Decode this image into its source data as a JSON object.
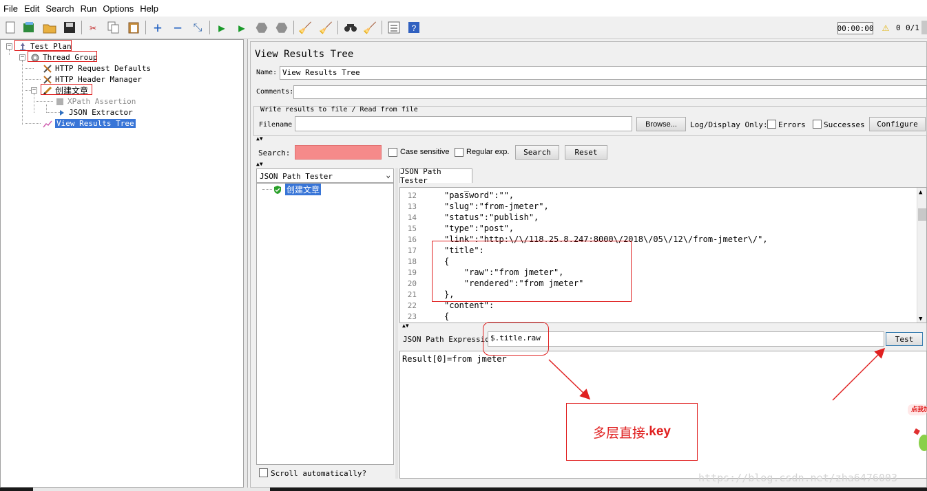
{
  "menu": [
    "File",
    "Edit",
    "Search",
    "Run",
    "Options",
    "Help"
  ],
  "toolbar": {
    "timer": "00:00:00",
    "warnings": "0",
    "threads": "0/1",
    "icons": [
      "new-icon",
      "templates-icon",
      "open-icon",
      "save-icon",
      "cut-icon",
      "copy-icon",
      "paste-icon",
      "expand-icon",
      "collapse-icon",
      "toggle-icon",
      "start-icon",
      "start-no-pause-icon",
      "stop-icon",
      "shutdown-icon",
      "clear-icon",
      "clear-all-icon",
      "search-icon",
      "reset-search-icon",
      "function-helper-icon",
      "help-icon"
    ]
  },
  "tree": {
    "test_plan": "Test Plan",
    "thread_group": "Thread Group",
    "http_defaults": "HTTP Request Defaults",
    "header_manager": "HTTP Header Manager",
    "sampler": "创建文章",
    "xpath": "XPath Assertion",
    "json_extractor": "JSON Extractor",
    "view_results": "View Results Tree"
  },
  "panel": {
    "title": "View Results Tree",
    "name_label": "Name:",
    "name_value": "View Results Tree",
    "comments_label": "Comments:",
    "write_section": "Write results to file / Read from file",
    "filename_label": "Filename",
    "filename_value": "",
    "browse": "Browse...",
    "log_display": "Log/Display Only:",
    "errors": "Errors",
    "successes": "Successes",
    "configure": "Configure",
    "search_label": "Search:",
    "search_value": "",
    "case_sensitive": "Case sensitive",
    "regular_exp": "Regular exp.",
    "search_btn": "Search",
    "reset_btn": "Reset"
  },
  "results": {
    "renderer": "JSON Path Tester",
    "sample": "创建文章",
    "scroll_auto": "Scroll automatically?",
    "tab": "JSON Path Tester",
    "code_lines": [
      {
        "n": "12",
        "t": "\"password\":\"\","
      },
      {
        "n": "13",
        "t": "\"slug\":\"from-jmeter\","
      },
      {
        "n": "14",
        "t": "\"status\":\"publish\","
      },
      {
        "n": "15",
        "t": "\"type\":\"post\","
      },
      {
        "n": "16",
        "t": "\"link\":\"http:\\/\\/118.25.8.247:8000\\/2018\\/05\\/12\\/from-jmeter\\/\","
      },
      {
        "n": "17",
        "t": "\"title\":"
      },
      {
        "n": "18",
        "t": "{"
      },
      {
        "n": "19",
        "t": "    \"raw\":\"from jmeter\","
      },
      {
        "n": "20",
        "t": "    \"rendered\":\"from jmeter\""
      },
      {
        "n": "21",
        "t": "},"
      },
      {
        "n": "22",
        "t": "\"content\":"
      },
      {
        "n": "23",
        "t": "{"
      }
    ],
    "expr_label": "JSON Path Expression",
    "expr_value": "$.title.raw",
    "test_btn": "Test",
    "result_text": "Result[0]=from jmeter"
  },
  "annotation": {
    "note_prefix": "多层直接",
    "note_key": ".key",
    "watermark": "https://blog.csdn.net/zha6476003",
    "badge": "点我加"
  },
  "colors": {
    "selection": "#3875d7",
    "annotation_red": "#e02020",
    "search_highlight": "#f58a8a"
  }
}
